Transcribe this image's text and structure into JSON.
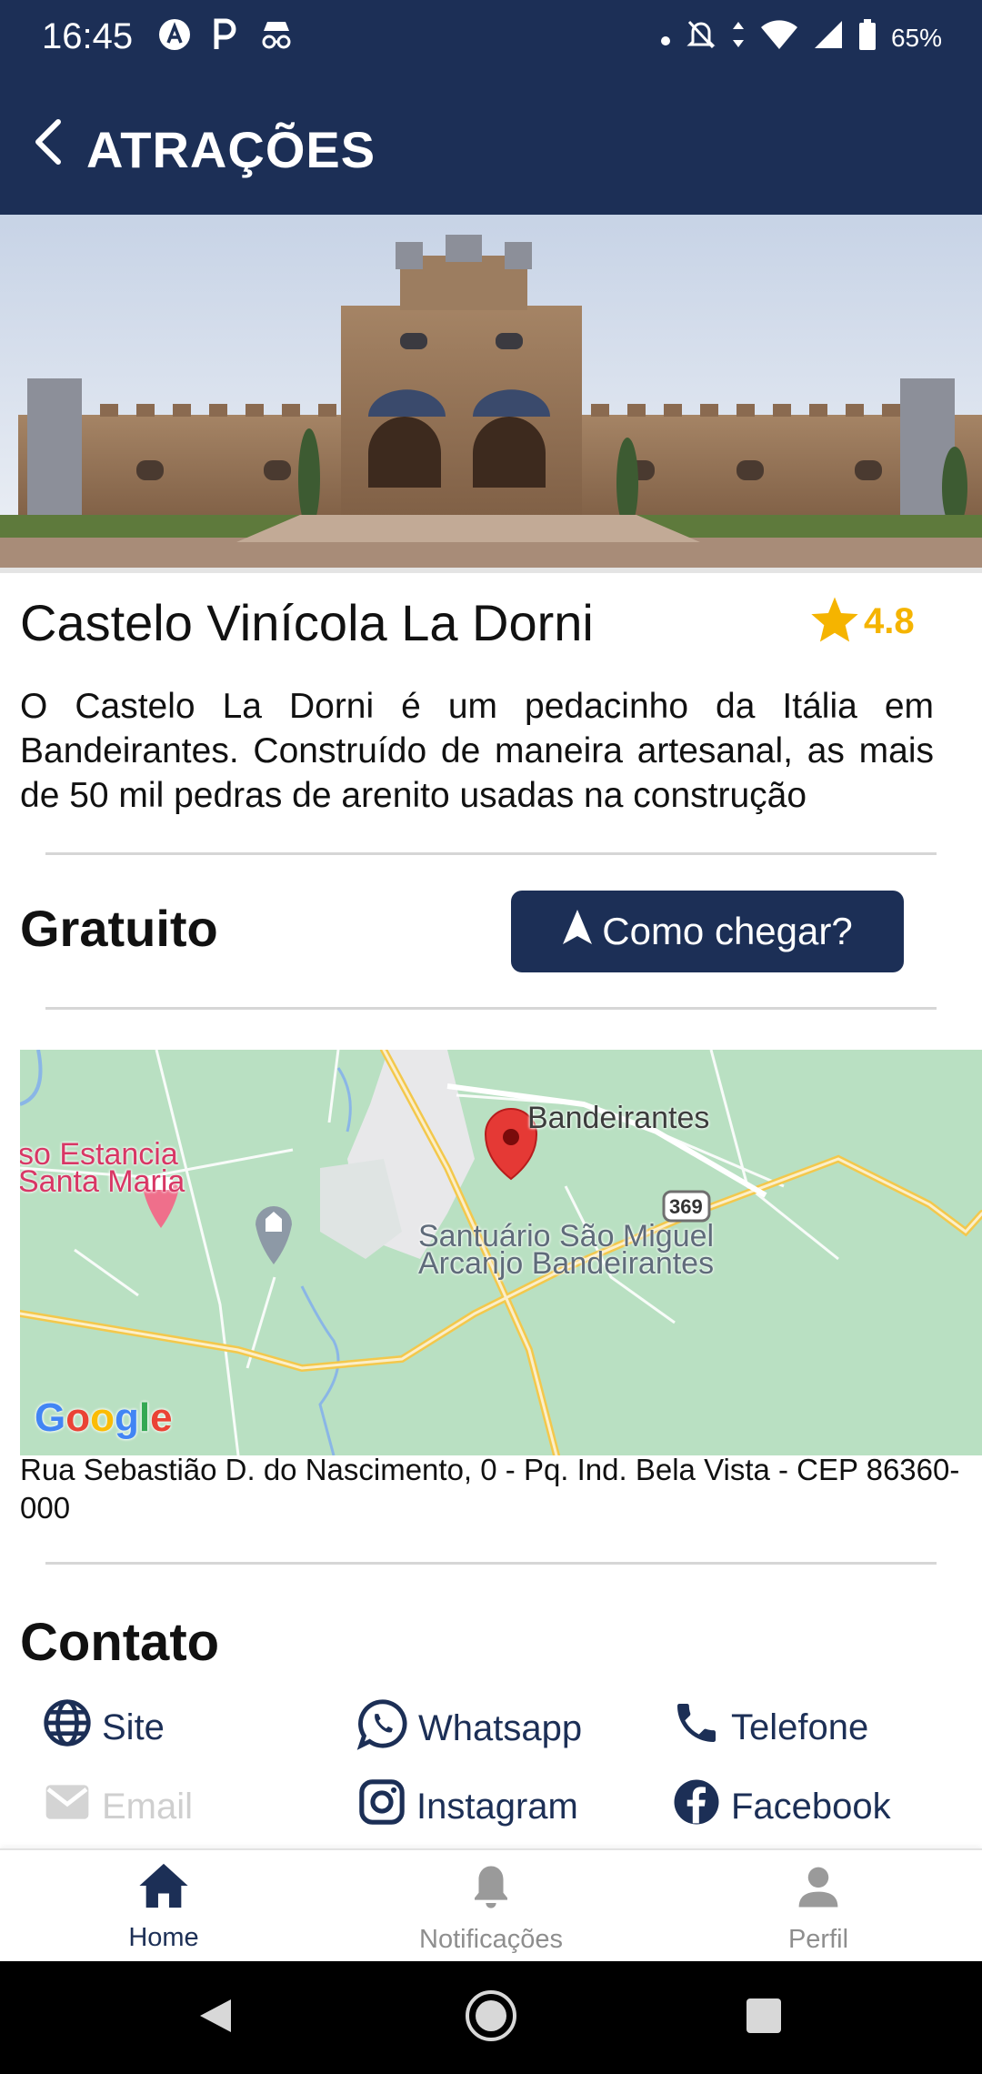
{
  "status_bar": {
    "time": "16:45",
    "battery": "65%",
    "left_icons": [
      "app-a-icon",
      "parking-p-icon",
      "incognito-icon"
    ],
    "right_icons": [
      "dot-icon",
      "bell-off-icon",
      "data-arrows-icon",
      "wifi-icon",
      "signal-icon",
      "battery-icon"
    ]
  },
  "app_bar": {
    "title": "ATRAÇÕES",
    "back_icon": "chevron-left-icon"
  },
  "attraction": {
    "name": "Castelo Vinícola La Dorni",
    "rating": "4.8",
    "rating_icon": "star-icon",
    "description": "O Castelo La Dorni é um pedacinho da Itália em Bandeirantes. Construído de maneira artesanal, as mais de 50 mil pedras de arenito usadas na construção",
    "price": "Gratuito",
    "directions_label": "Como chegar?",
    "directions_icon": "navigation-arrow-icon",
    "address": "Rua Sebastião D. do Nascimento, 0 - Pq. Ind. Bela Vista - CEP 86360-000"
  },
  "map": {
    "city_label": "Bandeirantes",
    "place1_line1": "so Estancia",
    "place1_line2": "Santa Maria",
    "place2_line1": "Santuário São Miguel",
    "place2_line2": "Arcanjo Bandeirantes",
    "road_label": "369",
    "logo": "Google"
  },
  "contact": {
    "title": "Contato",
    "items": [
      {
        "label": "Site",
        "icon": "globe-icon"
      },
      {
        "label": "Whatsapp",
        "icon": "whatsapp-icon"
      },
      {
        "label": "Telefone",
        "icon": "phone-icon"
      },
      {
        "label": "Email",
        "icon": "mail-icon"
      },
      {
        "label": "Instagram",
        "icon": "instagram-icon"
      },
      {
        "label": "Facebook",
        "icon": "facebook-icon"
      }
    ]
  },
  "bottom_nav": {
    "items": [
      {
        "label": "Home",
        "icon": "home-icon"
      },
      {
        "label": "Notificações",
        "icon": "bell-icon"
      },
      {
        "label": "Perfil",
        "icon": "person-icon"
      }
    ]
  },
  "colors": {
    "primary": "#1c2f56",
    "star": "#f5b400",
    "map_bg": "#b9e0c2",
    "marker": "#e53935"
  }
}
